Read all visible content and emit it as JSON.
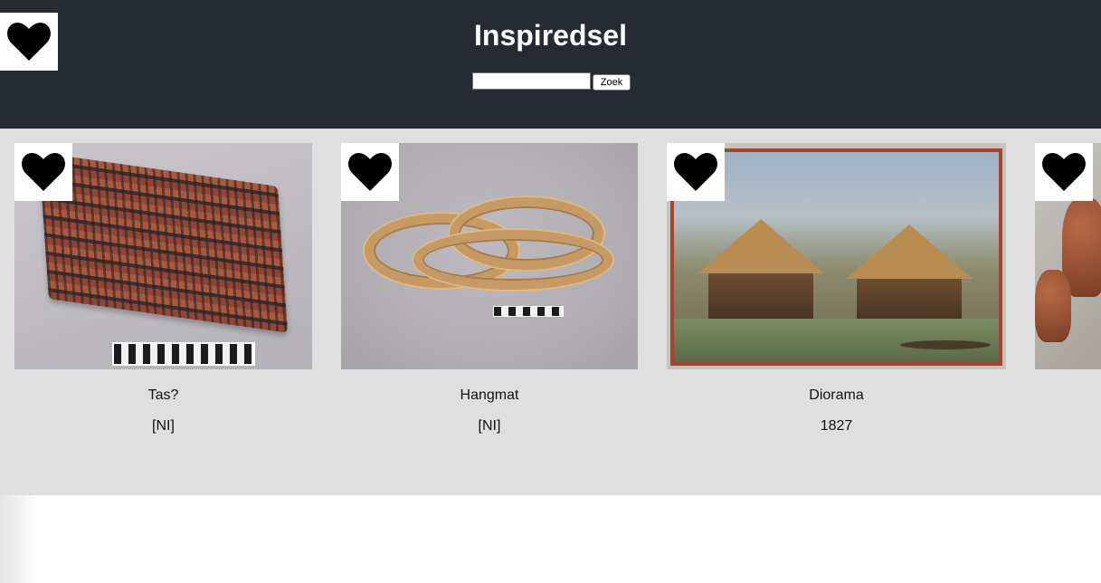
{
  "header": {
    "title": "Inspiredsel",
    "search_placeholder": "",
    "search_value": "",
    "search_button": "Zoek"
  },
  "items": [
    {
      "title": "Tas?",
      "date": "[NI]"
    },
    {
      "title": "Hangmat",
      "date": "[NI]"
    },
    {
      "title": "Diorama",
      "date": "1827"
    },
    {
      "title": "",
      "date": ""
    }
  ],
  "icons": {
    "favorites": "heart-icon",
    "like": "heart-icon"
  },
  "colors": {
    "header_bg": "#262a32",
    "gallery_bg": "#dfdfdf"
  }
}
